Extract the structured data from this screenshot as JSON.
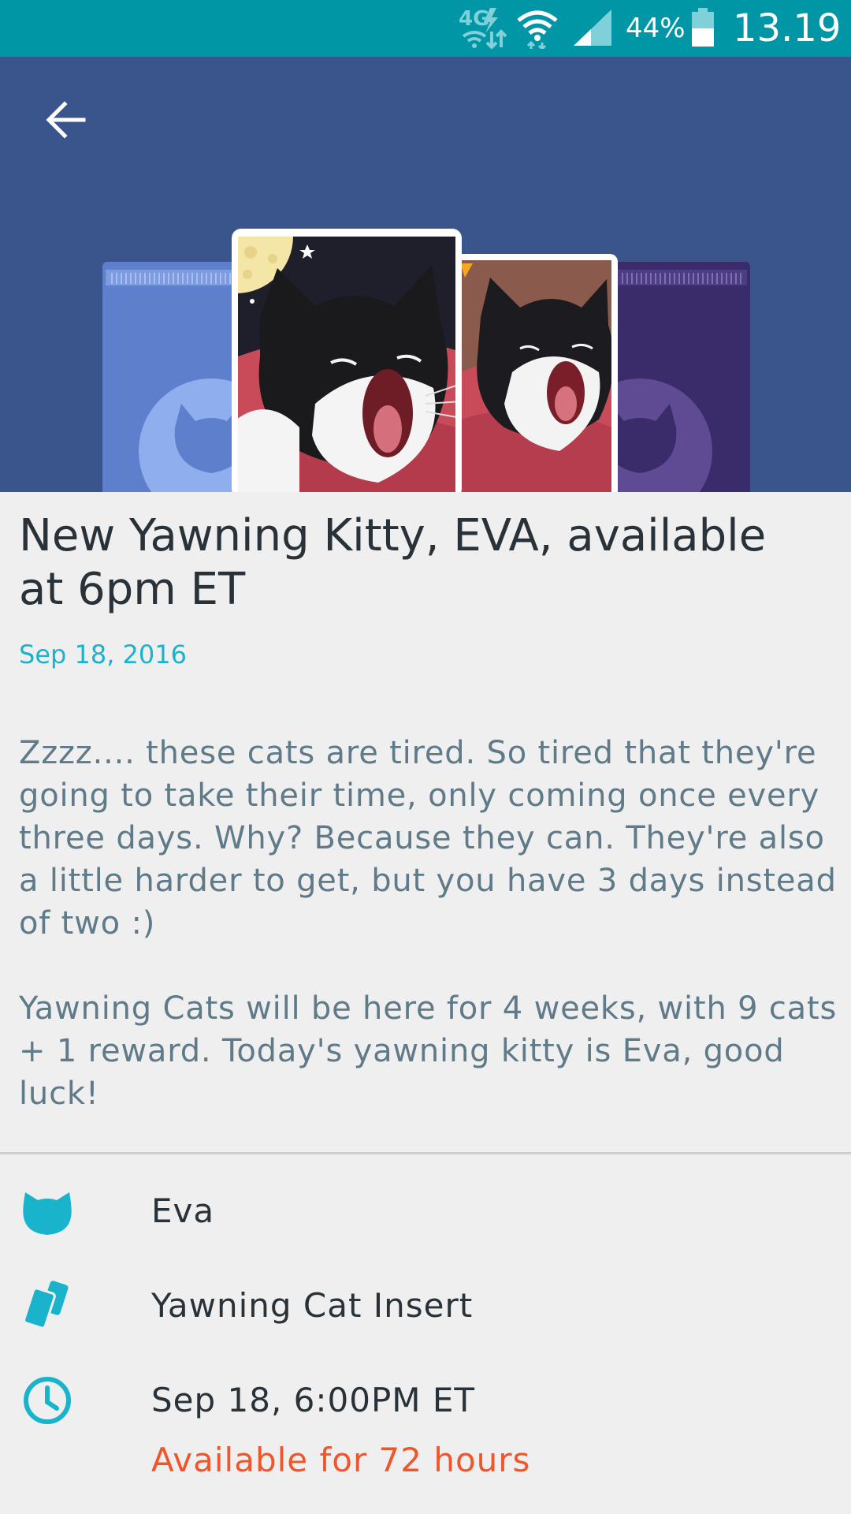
{
  "status_bar": {
    "network": "4G",
    "battery_percent": "44%",
    "time": "13.19",
    "icons": [
      "network-4g-icon",
      "wifi-icon",
      "signal-icon",
      "battery-icon"
    ]
  },
  "header": {
    "back_icon": "arrow-left-icon",
    "accent_color": "#39558b"
  },
  "article": {
    "title": "New Yawning Kitty, EVA, available at 6pm ET",
    "date": "Sep 18, 2016",
    "body": "Zzzz.... these cats are tired. So tired that they're going to take their time, only coming once every three days. Why? Because they can. They're also a little harder to get, but you have 3 days instead of two :)\n\nYawning Cats will be here for 4 weeks, with 9 cats + 1 reward. Today's yawning kitty is Eva, good luck!"
  },
  "details": {
    "cat_name": "Eva",
    "card_type": "Yawning Cat Insert",
    "schedule": "Sep 18, 6:00PM ET",
    "availability": "Available for 72 hours",
    "icons": [
      "cat-head-icon",
      "cards-icon",
      "clock-icon"
    ],
    "accent_color": "#19b4cc",
    "availability_color": "#f0562b"
  }
}
